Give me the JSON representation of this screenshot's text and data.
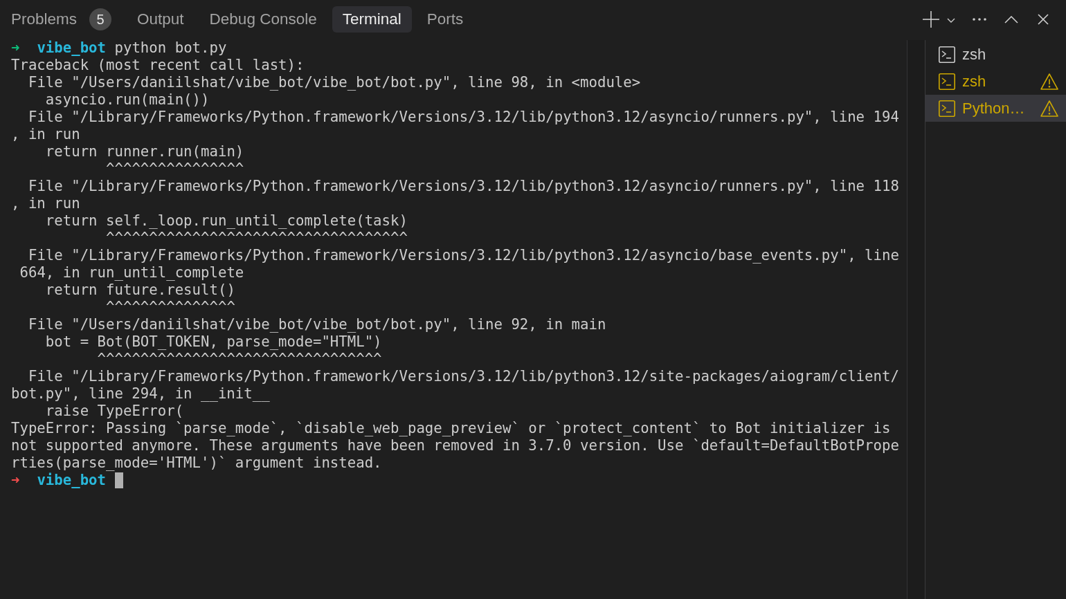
{
  "panel_tabs": [
    {
      "label": "Problems",
      "badge": "5",
      "selected": false
    },
    {
      "label": "Output",
      "selected": false
    },
    {
      "label": "Debug Console",
      "selected": false
    },
    {
      "label": "Terminal",
      "selected": true
    },
    {
      "label": "Ports",
      "selected": false
    }
  ],
  "terminal": {
    "lines": [
      {
        "kind": "prompt",
        "error": false,
        "arrow": "➜",
        "directory": "vibe_bot",
        "command": "python bot.py",
        "cursor": false
      },
      {
        "kind": "output",
        "text": "Traceback (most recent call last):"
      },
      {
        "kind": "output",
        "text": "  File \"/Users/daniilshat/vibe_bot/vibe_bot/bot.py\", line 98, in <module>"
      },
      {
        "kind": "output",
        "text": "    asyncio.run(main())"
      },
      {
        "kind": "output",
        "text": "  File \"/Library/Frameworks/Python.framework/Versions/3.12/lib/python3.12/asyncio/runners.py\", line 194"
      },
      {
        "kind": "output",
        "text": ", in run"
      },
      {
        "kind": "output",
        "text": "    return runner.run(main)"
      },
      {
        "kind": "marker",
        "text": "           ^^^^^^^^^^^^^^^^"
      },
      {
        "kind": "output",
        "text": "  File \"/Library/Frameworks/Python.framework/Versions/3.12/lib/python3.12/asyncio/runners.py\", line 118"
      },
      {
        "kind": "output",
        "text": ", in run"
      },
      {
        "kind": "output",
        "text": "    return self._loop.run_until_complete(task)"
      },
      {
        "kind": "marker",
        "text": "           ^^^^^^^^^^^^^^^^^^^^^^^^^^^^^^^^^^^"
      },
      {
        "kind": "output",
        "text": "  File \"/Library/Frameworks/Python.framework/Versions/3.12/lib/python3.12/asyncio/base_events.py\", line"
      },
      {
        "kind": "output",
        "text": " 664, in run_until_complete"
      },
      {
        "kind": "output",
        "text": "    return future.result()"
      },
      {
        "kind": "marker",
        "text": "           ^^^^^^^^^^^^^^^"
      },
      {
        "kind": "output",
        "text": "  File \"/Users/daniilshat/vibe_bot/vibe_bot/bot.py\", line 92, in main"
      },
      {
        "kind": "output",
        "text": "    bot = Bot(BOT_TOKEN, parse_mode=\"HTML\")"
      },
      {
        "kind": "marker",
        "text": "          ^^^^^^^^^^^^^^^^^^^^^^^^^^^^^^^^^"
      },
      {
        "kind": "output",
        "text": "  File \"/Library/Frameworks/Python.framework/Versions/3.12/lib/python3.12/site-packages/aiogram/client/"
      },
      {
        "kind": "output",
        "text": "bot.py\", line 294, in __init__"
      },
      {
        "kind": "output",
        "text": "    raise TypeError("
      },
      {
        "kind": "output",
        "text": "TypeError: Passing `parse_mode`, `disable_web_page_preview` or `protect_content` to Bot initializer is"
      },
      {
        "kind": "output",
        "text": "not supported anymore. These arguments have been removed in 3.7.0 version. Use `default=DefaultBotPrope"
      },
      {
        "kind": "output",
        "text": "rties(parse_mode='HTML')` argument instead."
      },
      {
        "kind": "prompt",
        "error": true,
        "arrow": "➜",
        "directory": "vibe_bot",
        "cursor": true
      }
    ]
  },
  "terminal_list": [
    {
      "label": "zsh",
      "warning": false,
      "selected": false
    },
    {
      "label": "zsh",
      "warning": true,
      "selected": false
    },
    {
      "label": "Python…",
      "warning": true,
      "selected": true
    }
  ]
}
